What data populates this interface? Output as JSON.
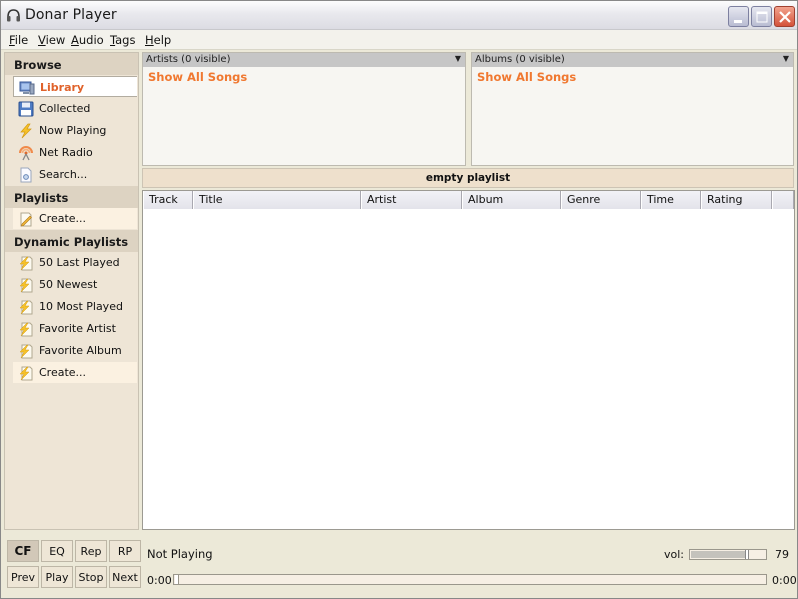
{
  "window": {
    "title": "Donar Player",
    "controls": [
      "minimize",
      "maximize",
      "close"
    ]
  },
  "menu": [
    {
      "label": "File",
      "mnemonic": "F"
    },
    {
      "label": "View",
      "mnemonic": "V"
    },
    {
      "label": "Audio",
      "mnemonic": "A"
    },
    {
      "label": "Tags",
      "mnemonic": "T"
    },
    {
      "label": "Help",
      "mnemonic": "H"
    }
  ],
  "sidebar": {
    "browse_header": "Browse",
    "browse_items": [
      {
        "label": "Library",
        "icon": "monitor-icon",
        "selected": true
      },
      {
        "label": "Collected",
        "icon": "floppy-disk-icon"
      },
      {
        "label": "Now Playing",
        "icon": "lightning-icon"
      },
      {
        "label": "Net Radio",
        "icon": "radio-antenna-icon"
      },
      {
        "label": "Search...",
        "icon": "search-document-icon"
      }
    ],
    "playlists_header": "Playlists",
    "playlist_items": [
      {
        "label": "Create...",
        "icon": "pencil-document-icon"
      }
    ],
    "dynamic_header": "Dynamic Playlists",
    "dynamic_items": [
      {
        "label": "50 Last Played",
        "icon": "dynamic-playlist-icon"
      },
      {
        "label": "50 Newest",
        "icon": "dynamic-playlist-icon"
      },
      {
        "label": "10 Most Played",
        "icon": "dynamic-playlist-icon"
      },
      {
        "label": "Favorite Artist",
        "icon": "dynamic-playlist-icon"
      },
      {
        "label": "Favorite Album",
        "icon": "dynamic-playlist-icon"
      },
      {
        "label": "Create...",
        "icon": "dynamic-playlist-icon"
      }
    ]
  },
  "filters": {
    "artists": {
      "header": "Artists (0 visible)",
      "show_all": "Show All Songs"
    },
    "albums": {
      "header": "Albums (0 visible)",
      "show_all": "Show All Songs"
    }
  },
  "playlist": {
    "title": "empty playlist",
    "columns": [
      "Track",
      "Title",
      "Artist",
      "Album",
      "Genre",
      "Time",
      "Rating",
      ""
    ],
    "rows": []
  },
  "controls": {
    "toggles": [
      "CF",
      "EQ",
      "Rep",
      "RP"
    ],
    "toggle_active": "CF",
    "transport": [
      "Prev",
      "Play",
      "Stop",
      "Next"
    ],
    "status": "Not Playing",
    "elapsed": "0:00",
    "total": "0:00",
    "progress_percent": 0,
    "volume_label": "vol:",
    "volume": 79
  },
  "colors": {
    "accent": "#e0622a",
    "show_all": "#f07830",
    "sidebar_bg": "#eee5d6",
    "header_bg": "#ddd3c2"
  }
}
